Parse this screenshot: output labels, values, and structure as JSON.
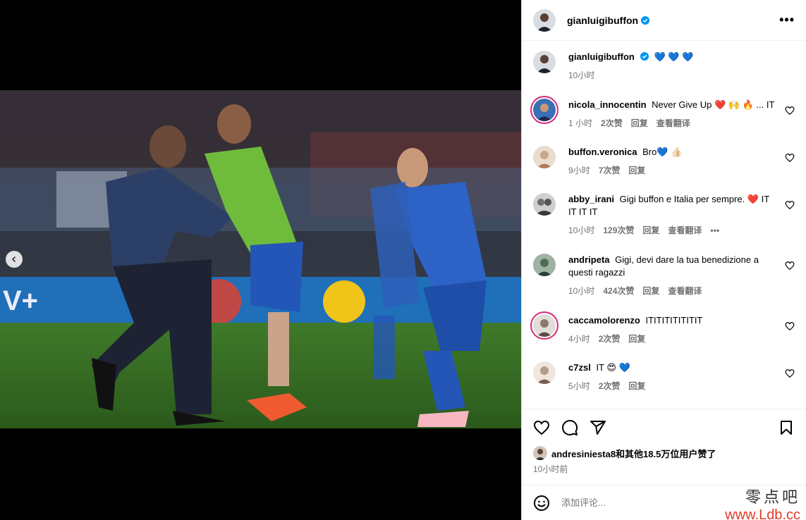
{
  "post": {
    "username": "gianluigibuffon",
    "more_icon": "more-horizontal-icon"
  },
  "caption": {
    "username": "gianluigibuffon",
    "text": "💙 💙 💙",
    "time": "10小时"
  },
  "comments": [
    {
      "user": "nicola_innocentin",
      "text": "Never Give Up ❤️ 🙌 🔥 ... IT",
      "time": "1 小时",
      "likes": "2次赞",
      "reply": "回复",
      "translate": "查看翻译",
      "ring": true,
      "avatar_color": "#3b6fb6"
    },
    {
      "user": "buffon.veronica",
      "text": "Bro💙 👍🏻",
      "time": "9小时",
      "likes": "7次赞",
      "reply": "回复",
      "translate": "",
      "ring": false,
      "avatar_color": "#c9a88a"
    },
    {
      "user": "abby_irani",
      "text": "Gigi buffon e Italia per sempre. ❤️ IT IT IT IT",
      "time": "10小时",
      "likes": "129次赞",
      "reply": "回复",
      "translate": "查看翻译",
      "more": "•••",
      "ring": false,
      "avatar_color": "#6d6d6d"
    },
    {
      "user": "andripeta",
      "text": "Gigi, devi dare la tua benedizione a questi ragazzi",
      "time": "10小时",
      "likes": "424次赞",
      "reply": "回复",
      "translate": "查看翻译",
      "ring": false,
      "avatar_color": "#4f6b55"
    },
    {
      "user": "caccamolorenzo",
      "text": "ITITITITITITIT",
      "time": "4小时",
      "likes": "2次赞",
      "reply": "回复",
      "translate": "",
      "ring": true,
      "avatar_color": "#8a7a70"
    },
    {
      "user": "c7zsl",
      "text": "IT 😍 💙",
      "time": "5小时",
      "likes": "2次赞",
      "reply": "回复",
      "translate": "",
      "ring": false,
      "avatar_color": "#b89a86"
    }
  ],
  "actions": {
    "like_icon": "heart-icon",
    "comment_icon": "comment-icon",
    "share_icon": "share-icon",
    "save_icon": "bookmark-icon"
  },
  "likes": {
    "text": "andresiniesta8和其他18.5万位用户赞了"
  },
  "timestamp": "10小时前",
  "add_comment": {
    "placeholder": "添加评论...",
    "emoji_icon": "smiley-icon"
  },
  "watermark": {
    "line1": "零点吧",
    "line2": "www.Ldb.cc"
  },
  "colors": {
    "verified": "#0095f6",
    "story_ring": "#d62976",
    "secondary_text": "#737373"
  }
}
